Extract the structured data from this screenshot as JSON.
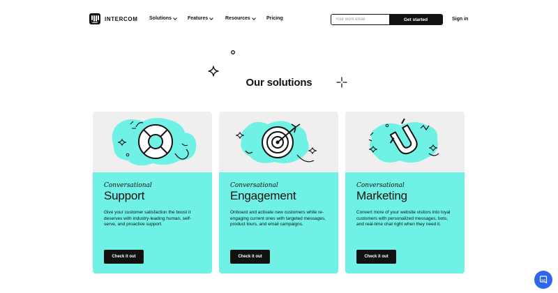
{
  "header": {
    "logo_text": "INTERCOM",
    "nav": [
      {
        "label": "Solutions",
        "has_dropdown": true,
        "icon": "chevron-down-icon"
      },
      {
        "label": "Features",
        "has_dropdown": true,
        "icon": "chevron-down-icon"
      },
      {
        "label": "Resources",
        "has_dropdown": true,
        "icon": "chevron-down-icon"
      },
      {
        "label": "Pricing",
        "has_dropdown": false
      }
    ],
    "email_placeholder": "Your work email",
    "email_value": "",
    "cta_label": "Get started",
    "sign_in_label": "Sign in"
  },
  "section": {
    "title": "Our solutions"
  },
  "cards": [
    {
      "eyebrow": "Conversational",
      "title": "Support",
      "description": "Give your customer satisfaction the boost it deserves with industry-leading human, self-serve, and proactive support.",
      "button_label": "Check it out",
      "icon": "lifebuoy-icon"
    },
    {
      "eyebrow": "Conversational",
      "title": "Engagement",
      "description": "Onboard and activate new customers while re-engaging current ones with targeted messages, product tours, and email campaigns.",
      "button_label": "Check it out",
      "icon": "target-icon"
    },
    {
      "eyebrow": "Conversational",
      "title": "Marketing",
      "description": "Convert more of your website visitors into loyal customers with personalized messages, bots, and real-time chat right when they need it.",
      "button_label": "Check it out",
      "icon": "magnet-icon"
    }
  ],
  "colors": {
    "accent": "#6ff1e6",
    "card_top": "#efefef",
    "button": "#111111",
    "launcher": "#2e68ea"
  },
  "chat_launcher_icon": "chat-bubble-icon"
}
